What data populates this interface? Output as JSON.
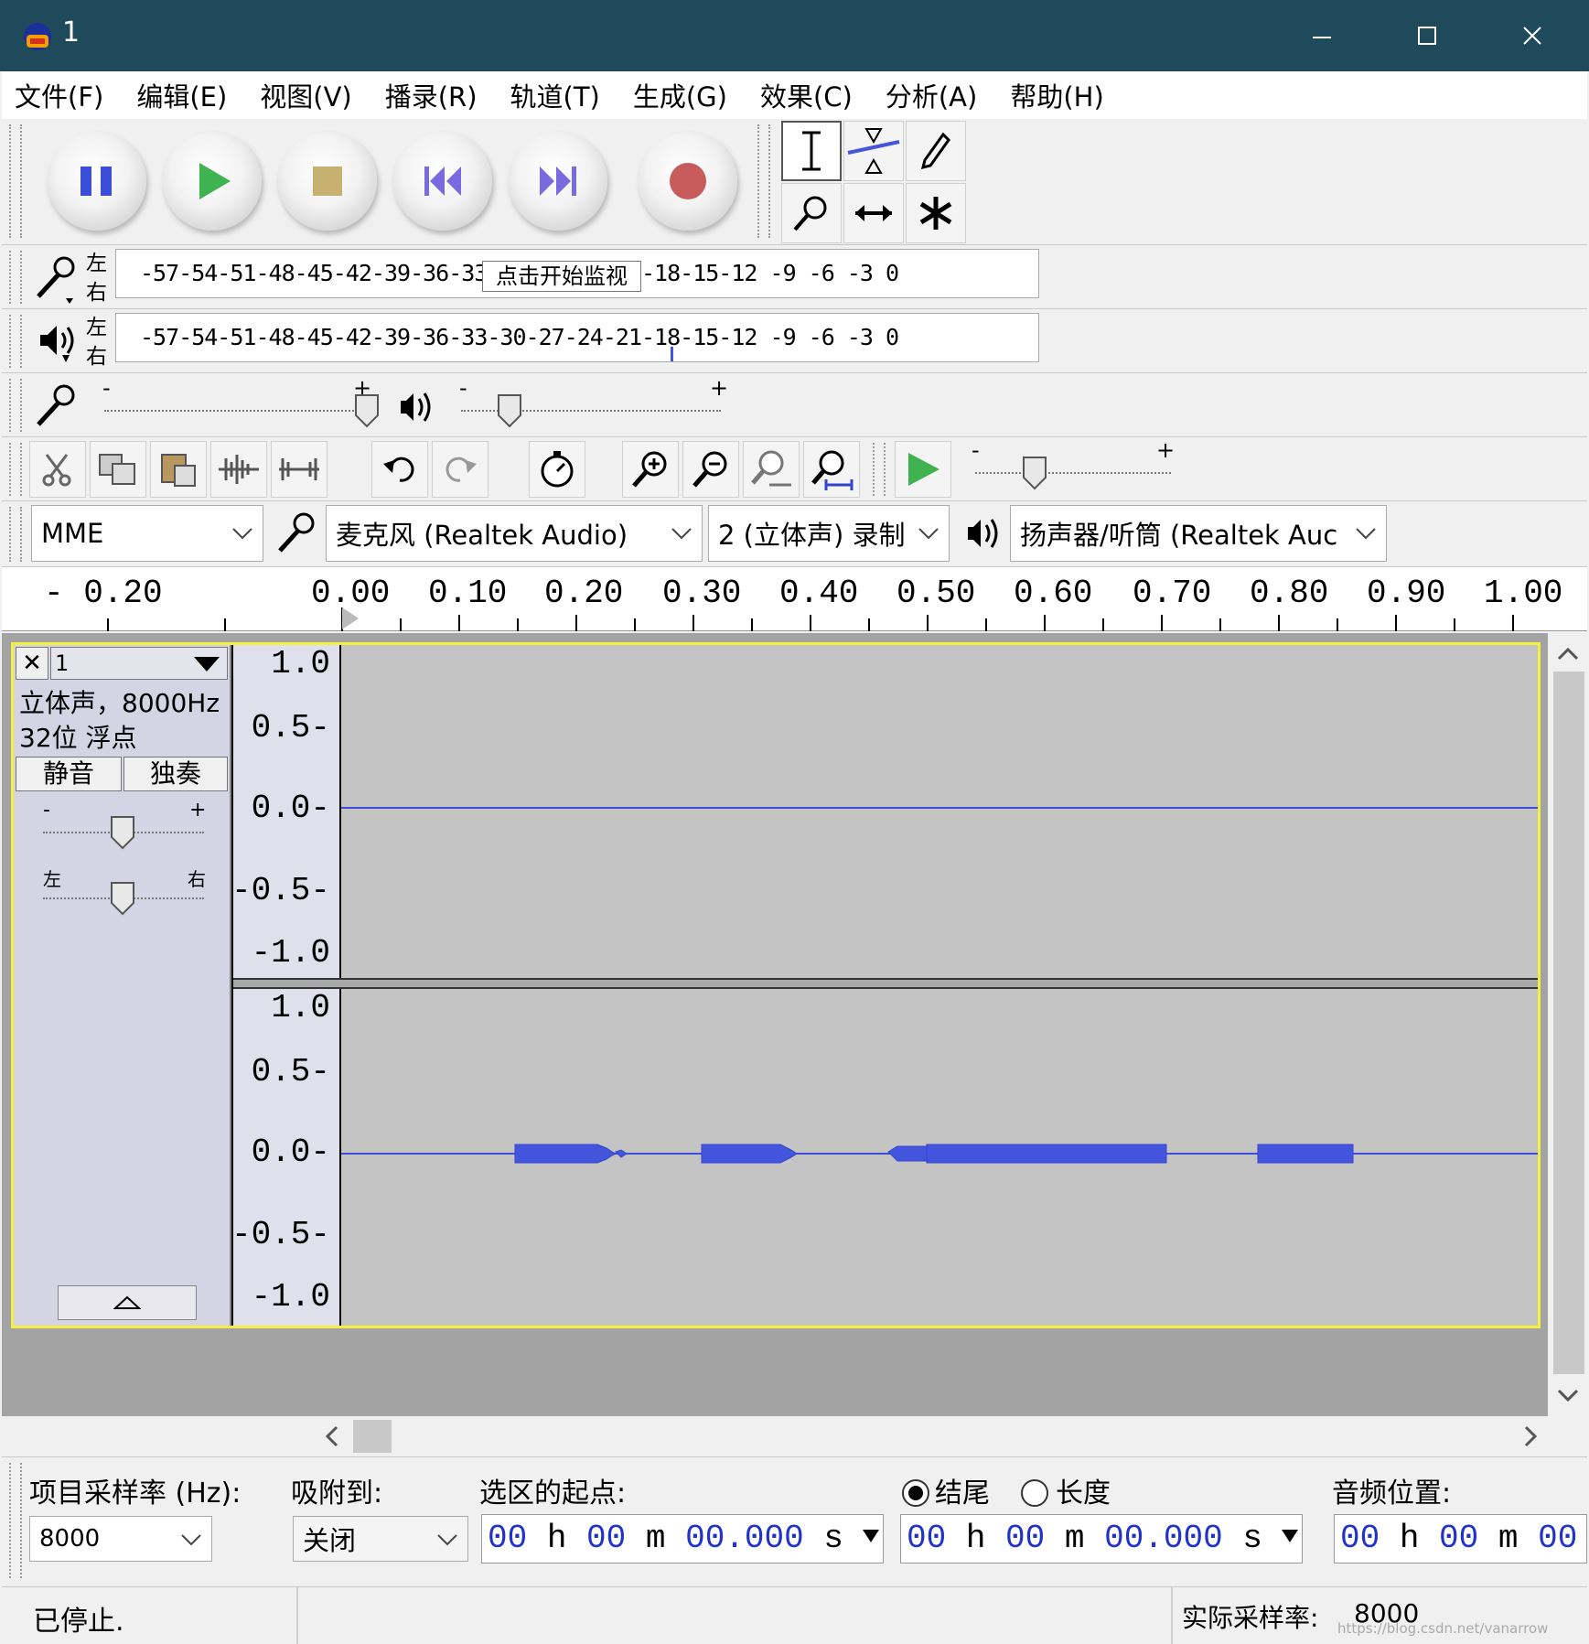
{
  "window": {
    "title": "1"
  },
  "menu": [
    "文件(F)",
    "编辑(E)",
    "视图(V)",
    "播录(R)",
    "轨道(T)",
    "生成(G)",
    "效果(C)",
    "分析(A)",
    "帮助(H)"
  ],
  "meters": {
    "record_scale": "-57-54-51-48-45-42-39-36-33-30-27-24-21-18-15-12 -9  -6  -3  0",
    "play_scale": "-57-54-51-48-45-42-39-36-33-30-27-24-21-18-15-12 -9  -6  -3  0",
    "left": "左",
    "right": "右",
    "monitor_tooltip": "点击开始监视"
  },
  "mixer": {
    "minus": "-",
    "plus": "+"
  },
  "device": {
    "host": "MME",
    "recording_device": "麦克风 (Realtek Audio)",
    "channels": "2 (立体声) 录制",
    "playback_device": "扬声器/听筒 (Realtek Auc"
  },
  "ruler": {
    "ticks": [
      "- 0.20",
      "0.00",
      "0.10",
      "0.20",
      "0.30",
      "0.40",
      "0.50",
      "0.60",
      "0.70",
      "0.80",
      "0.90",
      "1.00"
    ]
  },
  "track": {
    "name": "1",
    "close": "✕",
    "info_line1": "立体声，8000Hz",
    "info_line2": "32位 浮点",
    "mute": "静音",
    "solo": "独奏",
    "gain_minus": "-",
    "gain_plus": "+",
    "pan_left": "左",
    "pan_right": "右",
    "scale": [
      "1.0",
      "0.5-",
      "0.0-",
      "-0.5-",
      "-1.0"
    ]
  },
  "selection": {
    "rate_label": "项目采样率 (Hz):",
    "rate_value": "8000",
    "snap_label": "吸附到:",
    "snap_value": "关闭",
    "start_label": "选区的起点:",
    "end_radio": "结尾",
    "length_radio": "长度",
    "audio_pos_label": "音频位置:",
    "start_time": {
      "h": "00",
      "hu": "h",
      "m": "00",
      "mu": "m",
      "s": "00.000",
      "su": "s"
    },
    "end_time": {
      "h": "00",
      "hu": "h",
      "m": "00",
      "mu": "m",
      "s": "00.000",
      "su": "s"
    },
    "pos_time": {
      "h": "00",
      "hu": "h",
      "m": "00",
      "mu": "m",
      "s": "00"
    }
  },
  "status": {
    "state": "已停止.",
    "actual_rate_label": "实际采样率:",
    "actual_rate_value": "8000",
    "watermark": "https://blog.csdn.net/vanarrow"
  },
  "colors": {
    "titlebar": "#1f4a5c",
    "waveform": "#3d4fd8",
    "track_border": "#f5f040",
    "play_green": "#3fb34f",
    "record_red": "#c85c5c"
  }
}
